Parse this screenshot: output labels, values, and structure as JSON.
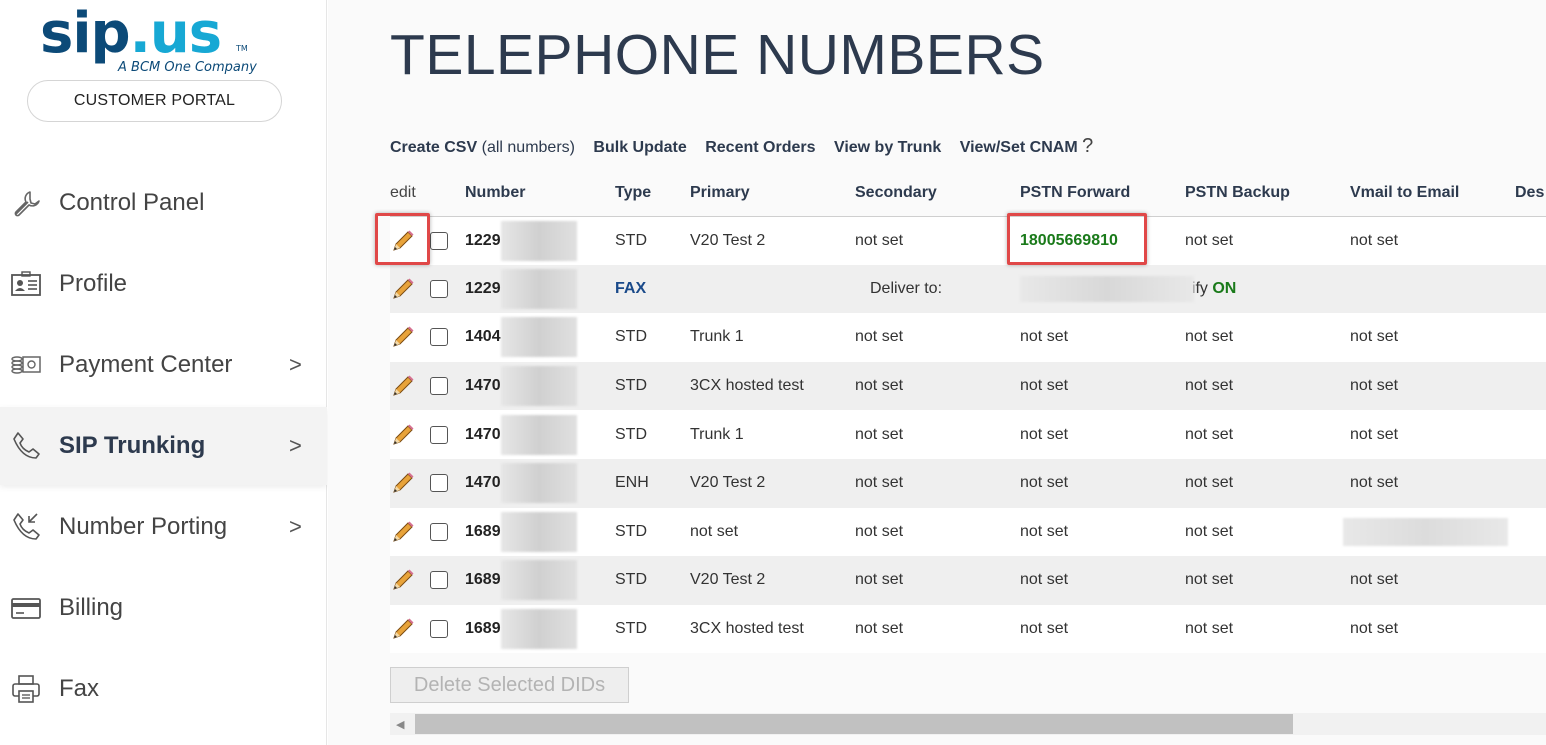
{
  "brand": {
    "logo_main_a": "sip",
    "logo_main_b": ".us",
    "logo_tm": "TM",
    "logo_sub": "A BCM One Company",
    "portal_button": "CUSTOMER PORTAL"
  },
  "sidebar": {
    "items": [
      {
        "label": "Control Panel",
        "icon": "wrench-icon",
        "chevron": ""
      },
      {
        "label": "Profile",
        "icon": "id-card-icon",
        "chevron": ""
      },
      {
        "label": "Payment Center",
        "icon": "cash-icon",
        "chevron": ">"
      },
      {
        "label": "SIP Trunking",
        "icon": "phone-icon",
        "chevron": ">"
      },
      {
        "label": "Number Porting",
        "icon": "phone-incoming-icon",
        "chevron": ">"
      },
      {
        "label": "Billing",
        "icon": "credit-card-icon",
        "chevron": ""
      },
      {
        "label": "Fax",
        "icon": "printer-icon",
        "chevron": ""
      }
    ],
    "active_index": 3
  },
  "page": {
    "title": "TELEPHONE NUMBERS"
  },
  "toolbar": {
    "create_csv": "Create CSV",
    "create_csv_note": "(all numbers)",
    "bulk_update": "Bulk Update",
    "recent_orders": "Recent Orders",
    "view_by_trunk": "View by Trunk",
    "view_set_cnam": "View/Set CNAM",
    "help": "?"
  },
  "table": {
    "headers": {
      "edit": "edit",
      "number": "Number",
      "type": "Type",
      "primary": "Primary",
      "secondary": "Secondary",
      "pstn_forward": "PSTN Forward",
      "pstn_backup": "PSTN Backup",
      "vmail": "Vmail to Email",
      "desc": "Des"
    },
    "rows": [
      {
        "number": "1229",
        "type": "STD",
        "primary": "V20 Test 2",
        "secondary": "not set",
        "pstn_forward": "18005669810",
        "pstn_backup": "not set",
        "vmail": "not set"
      },
      {
        "number": "1229",
        "type": "FAX",
        "deliver_label": "Deliver to:",
        "notify_label": "Notify",
        "notify_value": "ON"
      },
      {
        "number": "1404",
        "type": "STD",
        "primary": "Trunk 1",
        "secondary": "not set",
        "pstn_forward": "not set",
        "pstn_backup": "not set",
        "vmail": "not set"
      },
      {
        "number": "1470",
        "type": "STD",
        "primary": "3CX hosted test",
        "secondary": "not set",
        "pstn_forward": "not set",
        "pstn_backup": "not set",
        "vmail": "not set"
      },
      {
        "number": "1470",
        "type": "STD",
        "primary": "Trunk 1",
        "secondary": "not set",
        "pstn_forward": "not set",
        "pstn_backup": "not set",
        "vmail": "not set"
      },
      {
        "number": "1470",
        "type": "ENH",
        "primary": "V20 Test 2",
        "secondary": "not set",
        "pstn_forward": "not set",
        "pstn_backup": "not set",
        "vmail": "not set"
      },
      {
        "number": "1689",
        "type": "STD",
        "primary": "not set",
        "secondary": "not set",
        "pstn_forward": "not set",
        "pstn_backup": "not set",
        "vmail": ""
      },
      {
        "number": "1689",
        "type": "STD",
        "primary": "V20 Test 2",
        "secondary": "not set",
        "pstn_forward": "not set",
        "pstn_backup": "not set",
        "vmail": "not set"
      },
      {
        "number": "1689",
        "type": "STD",
        "primary": "3CX hosted test",
        "secondary": "not set",
        "pstn_forward": "not set",
        "pstn_backup": "not set",
        "vmail": "not set"
      }
    ]
  },
  "actions": {
    "delete_selected": "Delete Selected DIDs"
  },
  "colors": {
    "accent": "#2d3a4e",
    "highlight": "#e04848",
    "green": "#1a7a1a",
    "fax": "#1a4a8a"
  }
}
